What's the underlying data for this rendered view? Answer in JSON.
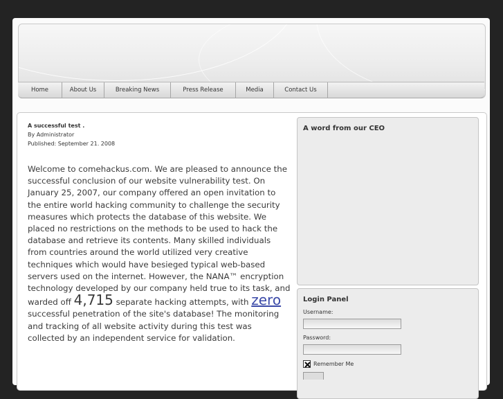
{
  "nav": {
    "items": [
      {
        "label": "Home"
      },
      {
        "label": "About Us"
      },
      {
        "label": "Breaking News"
      },
      {
        "label": "Press Release"
      },
      {
        "label": "Media"
      },
      {
        "label": "Contact Us"
      }
    ]
  },
  "article": {
    "title": "A successful test .",
    "author": "By Administrator",
    "published": "Published: September 21. 2008",
    "body_1": "Welcome to comehackus.com. We are pleased to announce the successful conclusion of our website vulnerability test. On January 25, 2007, our company offered an open invitation to the entire world hacking community to challenge the security measures which protects the database of this website. We placed no restrictions on the methods to be used to hack the database and retrieve its contents. Many skilled individuals from countries around the world utilized very creative techniques which would have besieged typical web-based servers used on the internet. However, the NANA™ encryption technology developed by our company held true to its task, and warded off ",
    "big_number": "4,715",
    "body_2": " separate hacking attempts, with ",
    "zero_word": "zero",
    "body_3": " successful penetration of the site's database! The monitoring and tracking of all website activity during this test was collected by an independent service for validation."
  },
  "ceo_panel": {
    "title": "A word from our CEO"
  },
  "login_panel": {
    "title": "Login Panel",
    "username_label": "Username:",
    "username_value": "",
    "password_label": "Password:",
    "password_value": "",
    "remember_label": "Remember Me",
    "remember_checked": true
  },
  "colors": {
    "background": "#232323",
    "link_accent": "#3b4aa8"
  }
}
